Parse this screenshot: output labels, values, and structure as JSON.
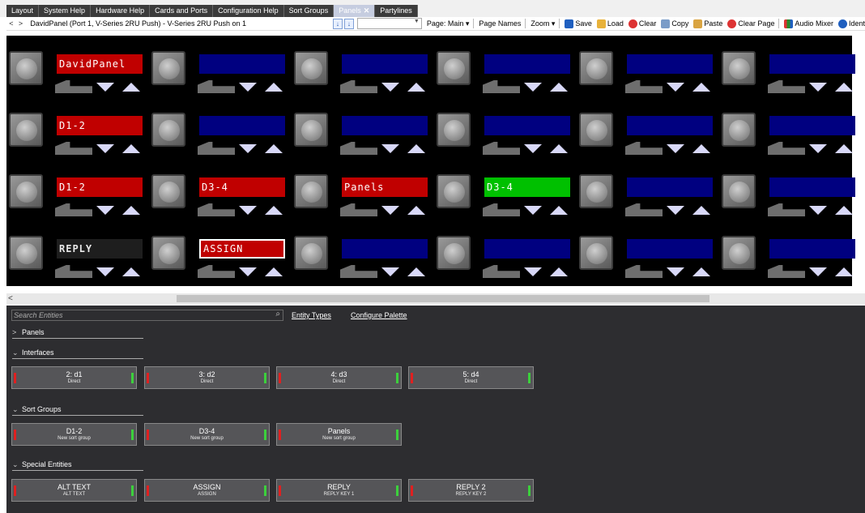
{
  "tabs": [
    {
      "label": "Layout"
    },
    {
      "label": "System Help"
    },
    {
      "label": "Hardware Help"
    },
    {
      "label": "Cards and Ports"
    },
    {
      "label": "Configuration Help"
    },
    {
      "label": "Sort Groups"
    },
    {
      "label": "Panels",
      "active": true,
      "close": "✕"
    },
    {
      "label": "Partylines"
    }
  ],
  "toolbar": {
    "back": "<",
    "forward": ">",
    "panel_title": "DavidPanel   (Port 1, V-Series 2RU Push)  -  V-Series 2RU Push on 1",
    "page_label": "Page: Main ▾",
    "page_names": "Page Names",
    "zoom": "Zoom ▾",
    "save": "Save",
    "load": "Load",
    "clear": "Clear",
    "copy": "Copy",
    "paste": "Paste",
    "clear_page": "Clear Page",
    "audio_mixer": "Audio Mixer",
    "ident": "Ident"
  },
  "panel_keys": [
    [
      {
        "text": "DavidPanel",
        "color": "red"
      },
      {
        "text": "",
        "color": "blue"
      },
      {
        "text": "",
        "color": "blue"
      },
      {
        "text": "",
        "color": "blue"
      },
      {
        "text": "",
        "color": "blue"
      },
      {
        "text": "",
        "color": "blue"
      }
    ],
    [
      {
        "text": "D1-2",
        "color": "red"
      },
      {
        "text": "",
        "color": "blue"
      },
      {
        "text": "",
        "color": "blue"
      },
      {
        "text": "",
        "color": "blue"
      },
      {
        "text": "",
        "color": "blue"
      },
      {
        "text": "",
        "color": "blue"
      }
    ],
    [
      {
        "text": "D1-2",
        "color": "red"
      },
      {
        "text": "D3-4",
        "color": "red"
      },
      {
        "text": "Panels",
        "color": "red"
      },
      {
        "text": "D3-4",
        "color": "green"
      },
      {
        "text": "",
        "color": "blue"
      },
      {
        "text": "",
        "color": "blue"
      }
    ],
    [
      {
        "text": "REPLY",
        "color": "dark"
      },
      {
        "text": "ASSIGN",
        "color": "sel"
      },
      {
        "text": "",
        "color": "blue"
      },
      {
        "text": "",
        "color": "blue"
      },
      {
        "text": "",
        "color": "blue"
      },
      {
        "text": "",
        "color": "blue"
      }
    ]
  ],
  "scroll": {
    "left_arrow": "<"
  },
  "palette": {
    "search_placeholder": "Search Entities",
    "search_icon": "⌕",
    "entity_types": "Entity Types",
    "configure_palette": "Configure Palette",
    "sections": {
      "panels": {
        "label": "Panels",
        "chevron": ">"
      },
      "interfaces": {
        "label": "Interfaces",
        "chevron": "⌄"
      },
      "sort_groups": {
        "label": "Sort Groups",
        "chevron": "⌄"
      },
      "special": {
        "label": "Special Entities",
        "chevron": "⌄"
      }
    },
    "interfaces": [
      {
        "name": "2: d1",
        "sub": "Direct"
      },
      {
        "name": "3: d2",
        "sub": "Direct"
      },
      {
        "name": "4: d3",
        "sub": "Direct"
      },
      {
        "name": "5: d4",
        "sub": "Direct"
      }
    ],
    "sort_groups": [
      {
        "name": "D1-2",
        "sub": "New sort group"
      },
      {
        "name": "D3-4",
        "sub": "New sort group"
      },
      {
        "name": "Panels",
        "sub": "New sort group"
      }
    ],
    "special": [
      {
        "name": "ALT TEXT",
        "sub": "ALT TEXT"
      },
      {
        "name": "ASSIGN",
        "sub": "ASSIGN"
      },
      {
        "name": "REPLY",
        "sub": "REPLY KEY 1"
      },
      {
        "name": "REPLY 2",
        "sub": "REPLY KEY 2"
      }
    ]
  }
}
